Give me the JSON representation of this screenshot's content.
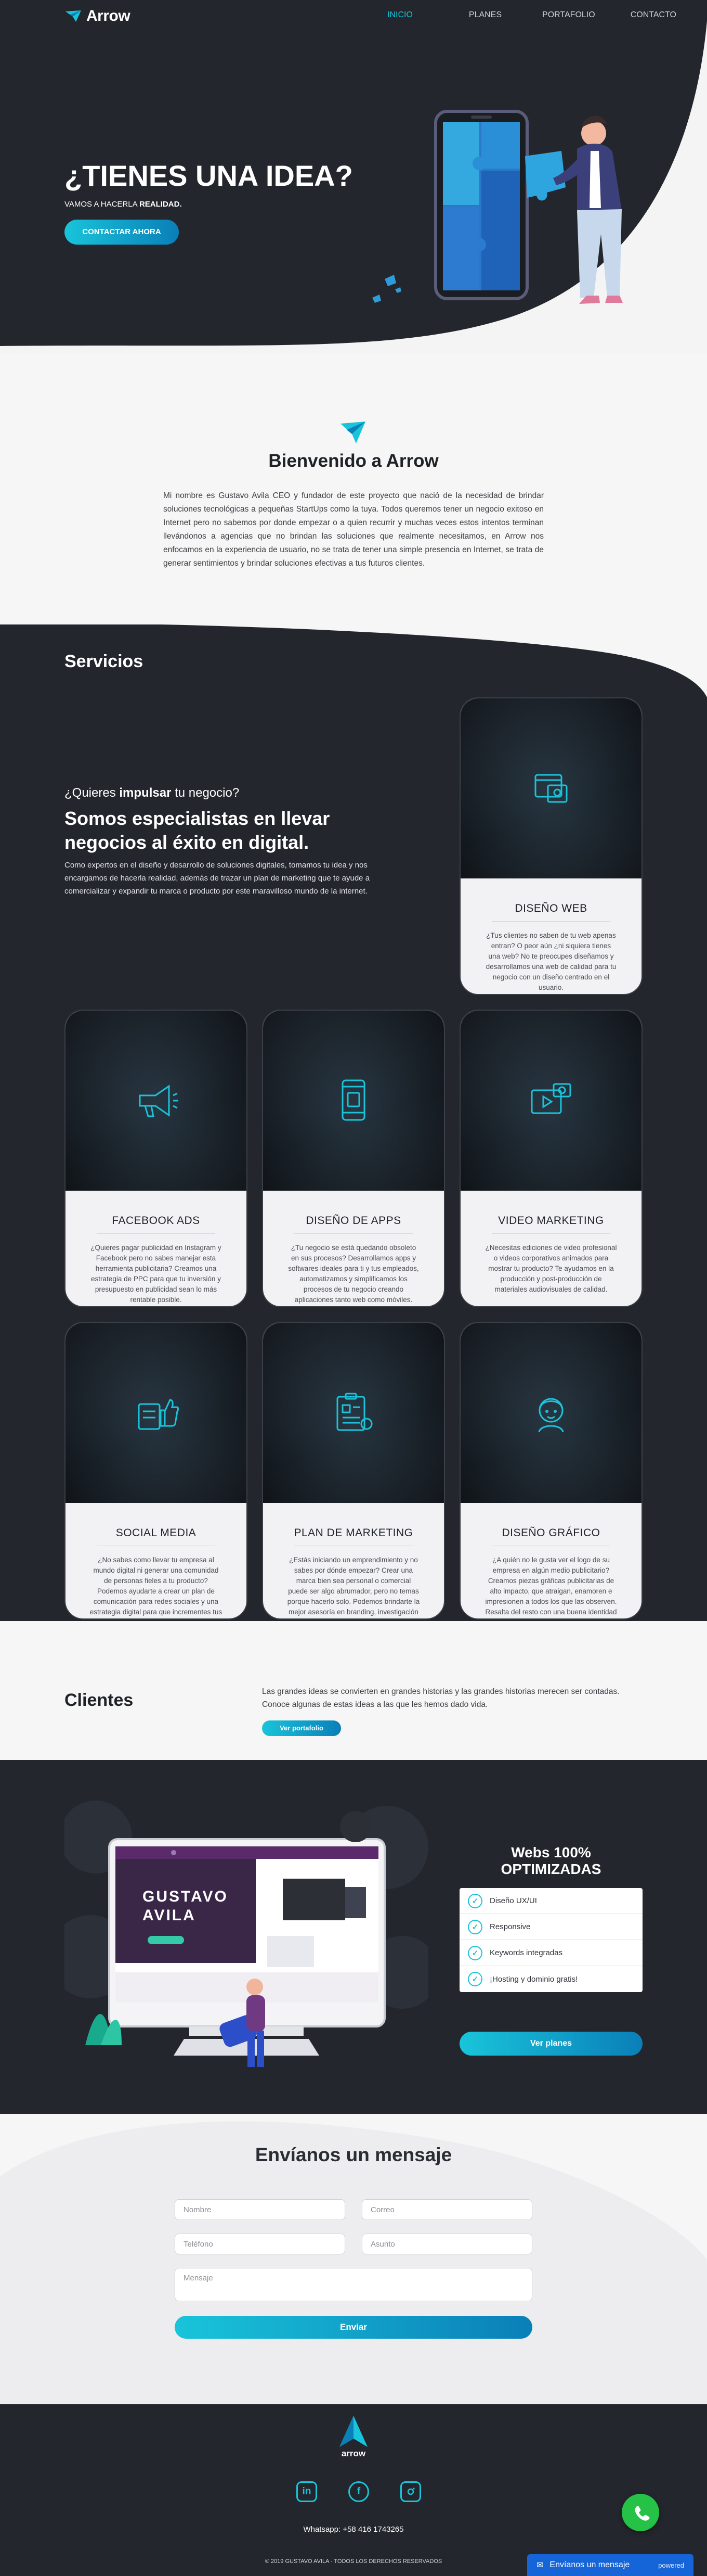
{
  "brand": {
    "logo_text": "Arrow",
    "accent": "#19c4da",
    "accent_dark": "#0a7fb8",
    "dark_bg": "#23262c"
  },
  "nav": {
    "items": [
      "INICIO",
      "PLANES",
      "PORTAFOLIO",
      "CONTACTO"
    ],
    "active": "INICIO"
  },
  "hero": {
    "title": "¿TIENES UNA IDEA?",
    "subtitle_prefix": "VAMOS A HACERLA ",
    "subtitle_bold": "REALIDAD.",
    "cta": "CONTACTAR AHORA"
  },
  "welcome": {
    "title": "Bienvenido a Arrow",
    "text": "Mi nombre es Gustavo Avila CEO y fundador de este proyecto que nació de la necesidad de brindar soluciones tecnológicas a pequeñas StartUps como la tuya. Todos queremos tener un negocio exitoso en Internet pero no sabemos por donde empezar o a quien recurrir y muchas veces estos intentos terminan llevándonos a agencias que no brindan las soluciones que realmente necesitamos, en Arrow nos enfocamos en la experiencia de usuario, no se trata de tener una simple presencia en Internet, se trata de generar sentimientos y brindar soluciones efectivas a tus futuros clientes."
  },
  "services": {
    "title": "Servicios",
    "question_prefix": "¿Quieres ",
    "question_bold": "impulsar",
    "question_suffix": " tu negocio?",
    "heading": "Somos especialistas en llevar negocios al éxito en digital.",
    "paragraph": "Como expertos en el diseño y desarrollo de soluciones digitales, tomamos tu idea y nos encargamos de hacerla realidad, además de trazar un plan de marketing que te ayude a comercializar y expandir tu marca o producto por este maravilloso mundo de la internet.",
    "cards": [
      {
        "title": "DISEÑO WEB",
        "icon": "web-design-icon",
        "text": "¿Tus clientes no saben de tu web apenas entran? O peor aún ¿ni siquiera tienes una web? No te preocupes diseñamos y desarrollamos una web de calidad para tu negocio con un diseño centrado en el usuario."
      },
      {
        "title": "FACEBOOK ADS",
        "icon": "megaphone-icon",
        "text": "¿Quieres pagar publicidad en Instagram y Facebook pero no sabes manejar esta herramienta publicitaria? Creamos una estrategia de PPC para que tu inversión y presupuesto en publicidad sean lo más rentable posible."
      },
      {
        "title": "DISEÑO DE APPS",
        "icon": "mobile-app-icon",
        "text": "¿Tu negocio se está quedando obsoleto en sus procesos? Desarrollamos apps y softwares ideales para ti y tus empleados, automatizamos y simplificamos los procesos de tu negocio creando aplicaciones tanto web como móviles."
      },
      {
        "title": "VIDEO MARKETING",
        "icon": "video-icon",
        "text": "¿Necesitas ediciones de video profesional o videos corporativos animados para mostrar tu producto? Te ayudamos en la producción y post-producción de materiales audiovisuales de calidad."
      },
      {
        "title": "SOCIAL MEDIA",
        "icon": "social-like-icon",
        "text": "¿No sabes como llevar tu empresa al mundo digital ni generar una comunidad de personas fieles a tu producto? Podemos ayudarte a crear un plan de comunicación para redes sociales y una estrategia digital para que incrementes tus ventas a través de social media."
      },
      {
        "title": "PLAN DE MARKETING",
        "icon": "marketing-plan-icon",
        "text": "¿Estás iniciando un emprendimiento y no sabes por dónde empezar? Crear una marca bien sea personal o comercial puede ser algo abrumador, pero no temas porque hacerlo solo. Podemos brindarte la mejor asesoría en branding, investigación de mercado y planes de mercadeo."
      },
      {
        "title": "DISEÑO GRÁFICO",
        "icon": "graphic-design-icon",
        "text": "¿A quién no le gusta ver el logo de su empresa en algún medio publicitario? Creamos piezas gráficas publicitarias de alto impacto, que atraigan, enamoren e impresionen a todos los que las observen. Resalta del resto con una buena identidad visual."
      }
    ]
  },
  "clients": {
    "title": "Clientes",
    "text": "Las grandes ideas se convierten en grandes historias y las grandes historias merecen ser contadas. Conoce algunas de estas ideas a las que les hemos dado vida.",
    "button": "Ver portafolio"
  },
  "optimized": {
    "title": "Webs 100% OPTIMIZADAS",
    "features": [
      "Diseño UX/UI",
      "Responsive",
      "Keywords integradas",
      "¡Hosting y dominio gratis!"
    ],
    "button": "Ver planes",
    "mockup_name_line1": "GUSTAVO",
    "mockup_name_line2": "AVILA"
  },
  "contact": {
    "title": "Envíanos un mensaje",
    "fields": {
      "nombre": "Nombre",
      "correo": "Correo",
      "telefono": "Teléfono",
      "asunto": "Asunto",
      "mensaje": "Mensaje"
    },
    "submit": "Enviar"
  },
  "footer": {
    "logo_text": "arrow",
    "whatsapp": "Whatsapp: +58 416 1743265",
    "copyright": "© 2019 GUSTAVO AVILA · TODOS LOS DERECHOS RESERVADOS",
    "socials": [
      "linkedin-icon",
      "facebook-icon",
      "instagram-icon"
    ]
  },
  "chat_widget": {
    "label": "Envíanos un mensaje",
    "brand": "powered"
  }
}
